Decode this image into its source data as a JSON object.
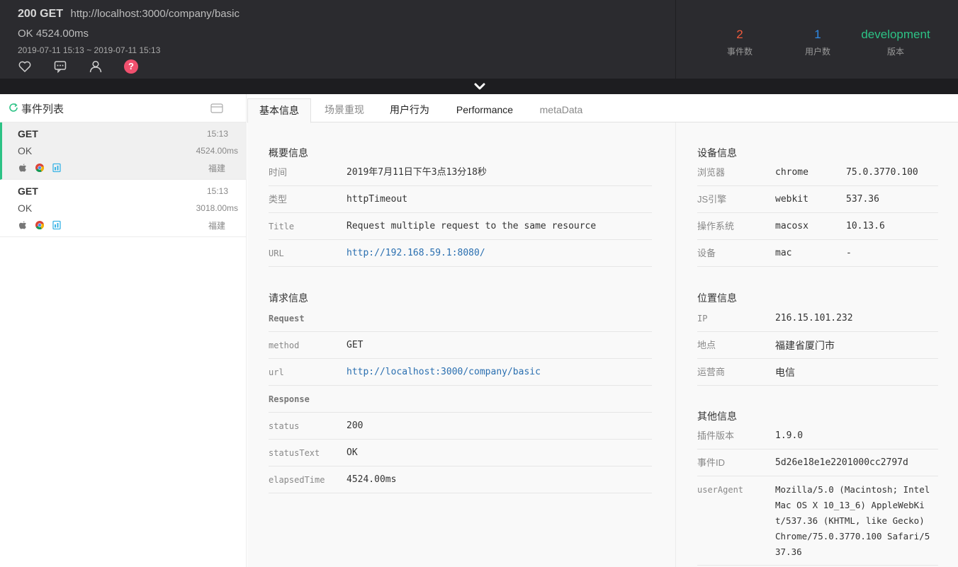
{
  "header": {
    "status_code": "200 GET",
    "url": "http://localhost:3000/company/basic",
    "status_line": "OK 4524.00ms",
    "time_range": "2019-07-11 15:13 ~ 2019-07-11 15:13",
    "icons": [
      "heart-icon",
      "comment-icon",
      "user-icon",
      "help-icon"
    ],
    "help_glyph": "?",
    "stats": [
      {
        "value": "2",
        "label": "事件数",
        "color": "#ef5a3c"
      },
      {
        "value": "1",
        "label": "用户数",
        "color": "#2f8ae6"
      },
      {
        "value": "development",
        "label": "版本",
        "color": "#2cc285"
      }
    ]
  },
  "sidebar": {
    "title": "事件列表",
    "events": [
      {
        "method": "GET",
        "time": "15:13",
        "status": "OK",
        "duration": "4524.00ms",
        "location": "福建"
      },
      {
        "method": "GET",
        "time": "15:13",
        "status": "OK",
        "duration": "3018.00ms",
        "location": "福建"
      }
    ]
  },
  "tabs": [
    {
      "label": "基本信息",
      "active": true
    },
    {
      "label": "场景重现"
    },
    {
      "label": "用户行为"
    },
    {
      "label": "Performance"
    },
    {
      "label": "metaData"
    }
  ],
  "overview": {
    "title": "概要信息",
    "rows": [
      {
        "key": "时间",
        "value": "2019年7月11日下午3点13分18秒"
      },
      {
        "key": "类型",
        "value": "httpTimeout"
      },
      {
        "key": "Title",
        "value": "Request multiple request to the same resource"
      },
      {
        "key": "URL",
        "value": "http://192.168.59.1:8080/"
      }
    ]
  },
  "request": {
    "title": "请求信息",
    "request_label": "Request",
    "method_key": "method",
    "method_value": "GET",
    "url_key": "url",
    "url_value": "http://localhost:3000/company/basic",
    "response_label": "Response",
    "status_key": "status",
    "status_value": "200",
    "statusText_key": "statusText",
    "statusText_value": "OK",
    "elapsed_key": "elapsedTime",
    "elapsed_value": "4524.00ms"
  },
  "device": {
    "title": "设备信息",
    "rows": [
      {
        "key": "浏览器",
        "value": "chrome",
        "extra": "75.0.3770.100"
      },
      {
        "key": "JS引擎",
        "value": "webkit",
        "extra": "537.36"
      },
      {
        "key": "操作系统",
        "value": "macosx",
        "extra": "10.13.6"
      },
      {
        "key": "设备",
        "value": "mac",
        "extra": "-"
      }
    ]
  },
  "location": {
    "title": "位置信息",
    "rows": [
      {
        "key": "IP",
        "value": "216.15.101.232"
      },
      {
        "key": "地点",
        "value": "福建省厦门市"
      },
      {
        "key": "运营商",
        "value": "电信"
      }
    ]
  },
  "other": {
    "title": "其他信息",
    "plugin_key": "插件版本",
    "plugin_value": "1.9.0",
    "event_id_key": "事件ID",
    "event_id_value": "5d26e18e1e2201000cc2797d",
    "ua_key": "userAgent",
    "ua_value": "Mozilla/5.0 (Macintosh; Intel Mac OS X 10_13_6) AppleWebKit/537.36 (KHTML, like Gecko) Chrome/75.0.3770.100 Safari/537.36"
  }
}
